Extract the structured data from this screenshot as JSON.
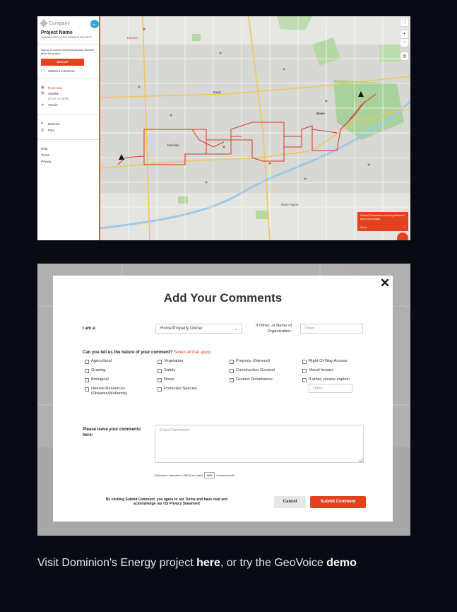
{
  "map_app": {
    "sidebar": {
      "logo_text": "Company",
      "collapse_icon": "arrow-left-icon",
      "project_title": "Project Name",
      "project_subtitle": "TRANSMISSION LINE REBUILD PROJECT",
      "prompt": "Sign up to submit comments and stay informed about the project",
      "signup_label": "SIGN UP",
      "submit_comment_label": "Submit a Comment",
      "layers": [
        {
          "label": "Road Map",
          "icon": "road-map-icon",
          "active": true
        },
        {
          "label": "Satellite",
          "icon": "satellite-icon",
          "active": false
        },
        {
          "label": "(Zoom to label)",
          "icon": "",
          "active": false
        },
        {
          "label": "Terrain",
          "icon": "terrain-icon",
          "active": false
        }
      ],
      "tools": [
        {
          "label": "Measure",
          "icon": "ruler-icon"
        },
        {
          "label": "Print",
          "icon": "printer-icon"
        }
      ],
      "links": [
        "Help",
        "Terms",
        "Privacy"
      ]
    },
    "map": {
      "controls": {
        "fullscreen": "⛶",
        "zoom_in": "+",
        "zoom_out": "−",
        "locate": "◎"
      },
      "cta_text": "Submit Comments and stay informed about the project",
      "cta_button": "Get It",
      "cta_arrow": "↓",
      "labels": [
        {
          "text": "Emmett",
          "color": "#555"
        },
        {
          "text": "Boise",
          "color": "#555"
        },
        {
          "text": "Meridian",
          "color": "#555"
        },
        {
          "text": "Eagle",
          "color": "#555"
        },
        {
          "text": "Boise Airport",
          "color": "#555"
        }
      ]
    }
  },
  "comment_form": {
    "title": "Add Your Comments",
    "close_icon": "close-icon",
    "i_am_label": "I am a:",
    "i_am_value": "Home/Property Owner",
    "org_label": "If Other, or Name of Organization:",
    "org_placeholder": "Other",
    "nature_question": "Can you tell us the nature of your comment?",
    "nature_hint": "Select all that apply",
    "checkboxes": [
      "Agricultural",
      "Vegetation",
      "Property (General)",
      "Right Of Way Access",
      "Grazing",
      "Safety",
      "Construction General",
      "Visual Impact",
      "Biological",
      "Noise",
      "Ground Disturbance",
      "If other, please explain",
      "Natural Resources (Streams/Wetlands)",
      "Protected Species"
    ],
    "other_explain_placeholder": "Other",
    "comments_label": "Please leave your comments here:",
    "comments_placeholder": "Enter Comments",
    "chars_prefix": "(Maximum characters: 8800) You have",
    "chars_count": "8800",
    "chars_suffix": "characters left.",
    "agree_text": "By clicking Submit Comment, you agree to our Terms and have read and acknowledge our US Privacy Statement",
    "cancel_label": "Cancel",
    "submit_label": "Submit Comment"
  },
  "caption": {
    "pre": "Visit Dominion's Energy project ",
    "link1": "here",
    "mid": ", or try the GeoVoice ",
    "link2": "demo"
  },
  "colors": {
    "accent": "#e3421f",
    "page_bg": "#080b14",
    "route": "#d9362a"
  }
}
